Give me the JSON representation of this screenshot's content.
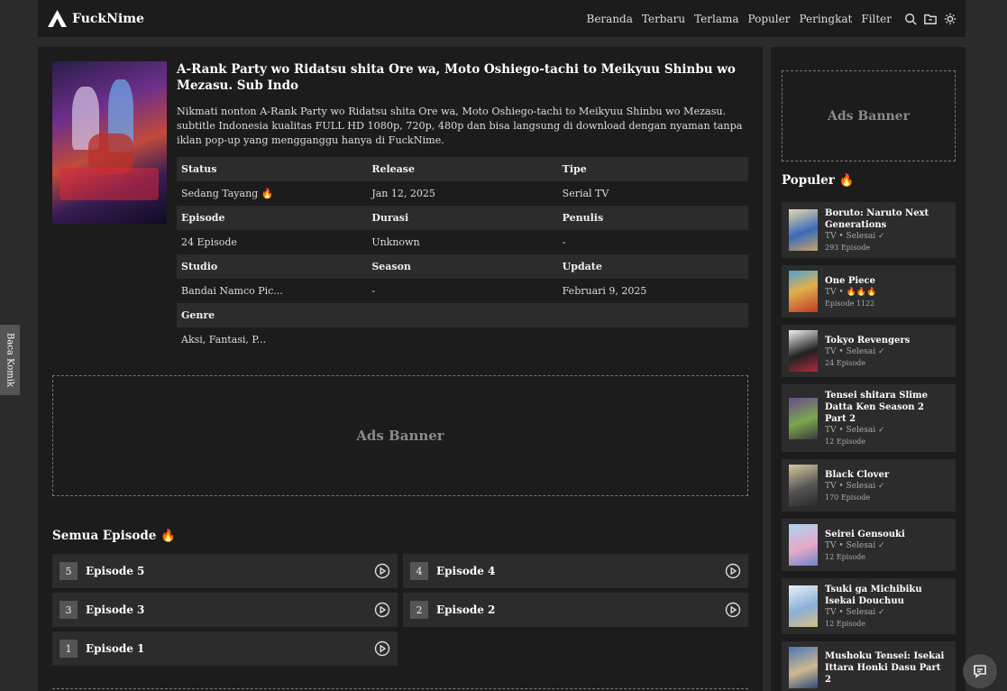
{
  "brand": {
    "name": "FuckNime"
  },
  "nav": {
    "links": [
      "Beranda",
      "Terbaru",
      "Terlama",
      "Populer",
      "Peringkat",
      "Filter"
    ],
    "icons": [
      "search-icon",
      "folder-icon",
      "sun-icon"
    ]
  },
  "anime": {
    "title": "A-Rank Party wo Ridatsu shita Ore wa, Moto Oshiego-tachi to Meikyuu Shinbu wo Mezasu. Sub Indo",
    "description": "Nikmati nonton A-Rank Party wo Ridatsu shita Ore wa, Moto Oshiego-tachi to Meikyuu Shinbu wo Mezasu. subtitle Indonesia kualitas FULL HD 1080p, 720p, 480p dan bisa langsung di download dengan nyaman tanpa iklan pop-up yang mengganggu hanya di FuckNime.",
    "meta": {
      "status_label": "Status",
      "status": "Sedang Tayang 🔥",
      "release_label": "Release",
      "release": "Jan 12, 2025",
      "tipe_label": "Tipe",
      "tipe": "Serial TV",
      "episode_label": "Episode",
      "episode": "24 Episode",
      "durasi_label": "Durasi",
      "durasi": "Unknown",
      "penulis_label": "Penulis",
      "penulis": "-",
      "studio_label": "Studio",
      "studio": "Bandai Namco Pic...",
      "season_label": "Season",
      "season": "-",
      "update_label": "Update",
      "update": "Februari 9, 2025",
      "genre_label": "Genre",
      "genre": "Aksi, Fantasi, P..."
    }
  },
  "ads": {
    "main": "Ads Banner",
    "side": "Ads Banner"
  },
  "episodes": {
    "heading": "Semua Episode 🔥",
    "items": [
      {
        "num": "5",
        "label": "Episode 5"
      },
      {
        "num": "4",
        "label": "Episode 4"
      },
      {
        "num": "3",
        "label": "Episode 3"
      },
      {
        "num": "2",
        "label": "Episode 2"
      },
      {
        "num": "1",
        "label": "Episode 1"
      }
    ]
  },
  "popular": {
    "heading": "Populer 🔥",
    "items": [
      {
        "title": "Boruto: Naruto Next Generations",
        "sub": "TV • Selesai ✓",
        "eps": "293 Episode"
      },
      {
        "title": "One Piece",
        "sub": "TV • 🔥🔥🔥",
        "eps": "Episode 1122"
      },
      {
        "title": "Tokyo Revengers",
        "sub": "TV • Selesai ✓",
        "eps": "24 Episode"
      },
      {
        "title": "Tensei shitara Slime Datta Ken Season 2 Part 2",
        "sub": "TV • Selesai ✓",
        "eps": "12 Episode"
      },
      {
        "title": "Black Clover",
        "sub": "TV • Selesai ✓",
        "eps": "170 Episode"
      },
      {
        "title": "Seirei Gensouki",
        "sub": "TV • Selesai ✓",
        "eps": "12 Episode"
      },
      {
        "title": "Tsuki ga Michibiku Isekai Douchuu",
        "sub": "TV • Selesai ✓",
        "eps": "12 Episode"
      },
      {
        "title": "Mushoku Tensei: Isekai Ittara Honki Dasu Part 2",
        "sub": "",
        "eps": ""
      }
    ]
  },
  "side_tab": {
    "label": "Baca Komik"
  },
  "colors": {
    "page": "#2b2b2b",
    "panel": "#1c1c1c",
    "row": "#2c2c2c"
  }
}
